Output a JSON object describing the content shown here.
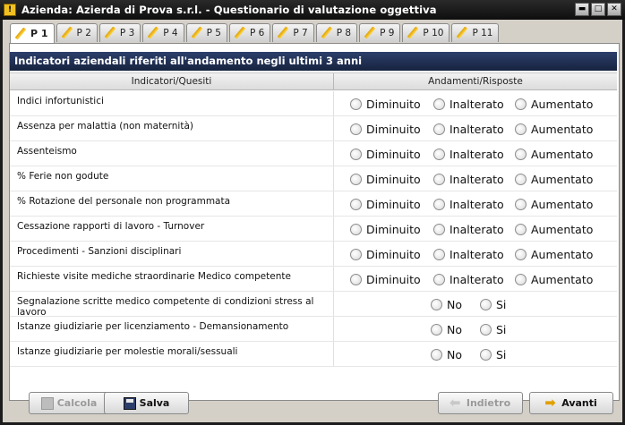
{
  "window": {
    "title": "Azienda: Azierda di Prova s.r.l. - Questionario di valutazione oggettiva",
    "buttons": [
      "minimize",
      "maximize",
      "close"
    ]
  },
  "tabs": [
    {
      "label": "P 1",
      "active": true
    },
    {
      "label": "P 2",
      "active": false
    },
    {
      "label": "P 3",
      "active": false
    },
    {
      "label": "P 4",
      "active": false
    },
    {
      "label": "P 5",
      "active": false
    },
    {
      "label": "P 6",
      "active": false
    },
    {
      "label": "P 7",
      "active": false
    },
    {
      "label": "P 8",
      "active": false
    },
    {
      "label": "P 9",
      "active": false
    },
    {
      "label": "P 10",
      "active": false
    },
    {
      "label": "P 11",
      "active": false
    }
  ],
  "section": {
    "title": "Indicatori aziendali riferiti all'andamento negli ultimi 3 anni",
    "col_question": "Indicatori/Quesiti",
    "col_answer": "Andamenti/Risposte"
  },
  "rows": [
    {
      "question": "Indici infortunistici",
      "options": [
        "Diminuito",
        "Inalterato",
        "Aumentato"
      ]
    },
    {
      "question": "Assenza per malattia (non maternità)",
      "options": [
        "Diminuito",
        "Inalterato",
        "Aumentato"
      ]
    },
    {
      "question": "Assenteismo",
      "options": [
        "Diminuito",
        "Inalterato",
        "Aumentato"
      ]
    },
    {
      "question": "% Ferie non godute",
      "options": [
        "Diminuito",
        "Inalterato",
        "Aumentato"
      ]
    },
    {
      "question": "% Rotazione del personale non programmata",
      "options": [
        "Diminuito",
        "Inalterato",
        "Aumentato"
      ]
    },
    {
      "question": "Cessazione rapporti di lavoro - Turnover",
      "options": [
        "Diminuito",
        "Inalterato",
        "Aumentato"
      ]
    },
    {
      "question": "Procedimenti - Sanzioni disciplinari",
      "options": [
        "Diminuito",
        "Inalterato",
        "Aumentato"
      ]
    },
    {
      "question": "Richieste visite mediche straordinarie Medico competente",
      "options": [
        "Diminuito",
        "Inalterato",
        "Aumentato"
      ]
    },
    {
      "question": "Segnalazione scritte medico competente di condizioni stress al lavoro",
      "options": [
        "No",
        "Si"
      ]
    },
    {
      "question": "Istanze giudiziarie per licenziamento - Demansionamento",
      "options": [
        "No",
        "Si"
      ]
    },
    {
      "question": "Istanze giudiziarie per molestie morali/sessuali",
      "options": [
        "No",
        "Si"
      ]
    }
  ],
  "footer": {
    "calcola": "Calcola",
    "salva": "Salva",
    "indietro": "Indietro",
    "avanti": "Avanti"
  },
  "colors": {
    "section_bg": "#1f2d4f",
    "titlebar_bg": "#151515",
    "arrow_accent": "#e0a000"
  }
}
